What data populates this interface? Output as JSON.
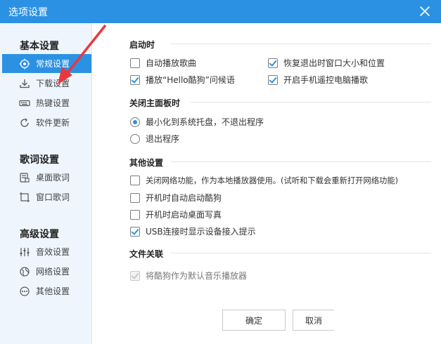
{
  "window": {
    "title": "选项设置"
  },
  "sidebar": {
    "groups": [
      {
        "title": "基本设置",
        "items": [
          {
            "label": "常规设置",
            "icon": "target-icon"
          },
          {
            "label": "下载设置",
            "icon": "download-icon"
          },
          {
            "label": "热键设置",
            "icon": "keyboard-icon"
          },
          {
            "label": "软件更新",
            "icon": "refresh-icon"
          }
        ]
      },
      {
        "title": "歌词设置",
        "items": [
          {
            "label": "桌面歌词",
            "icon": "desktop-lyrics-icon"
          },
          {
            "label": "窗口歌词",
            "icon": "window-lyrics-icon"
          }
        ]
      },
      {
        "title": "高级设置",
        "items": [
          {
            "label": "音效设置",
            "icon": "equalizer-icon"
          },
          {
            "label": "网络设置",
            "icon": "globe-icon"
          },
          {
            "label": "其他设置",
            "icon": "more-icon"
          }
        ]
      }
    ]
  },
  "sections": {
    "startup": {
      "title": "启动时",
      "options": [
        {
          "label": "自动播放歌曲",
          "checked": false
        },
        {
          "label": "恢复退出时窗口大小和位置",
          "checked": true
        },
        {
          "label": "播放“Hello酷狗”问候语",
          "checked": true
        },
        {
          "label": "开启手机遥控电脑播歌",
          "checked": true
        }
      ]
    },
    "close": {
      "title": "关闭主面板时",
      "options": [
        {
          "label": "最小化到系统托盘，不退出程序",
          "checked": true
        },
        {
          "label": "退出程序",
          "checked": false
        }
      ]
    },
    "other": {
      "title": "其他设置",
      "options": [
        {
          "label": "关闭网络功能，作为本地播放器使用。(试听和下载会重新打开网络功能)",
          "checked": false
        },
        {
          "label": "开机时自动启动酷狗",
          "checked": false
        },
        {
          "label": "开机时启动桌面写真",
          "checked": false
        },
        {
          "label": "USB连接时显示设备接入提示",
          "checked": true
        }
      ]
    },
    "file": {
      "title": "文件关联",
      "options": [
        {
          "label": "将酷狗作为默认音乐播放器",
          "checked": true,
          "disabled": true
        }
      ]
    }
  },
  "buttons": {
    "ok": "确定",
    "cancel": "取消"
  },
  "colors": {
    "accent": "#2b91e3",
    "annotation_arrow": "#e8383d"
  }
}
